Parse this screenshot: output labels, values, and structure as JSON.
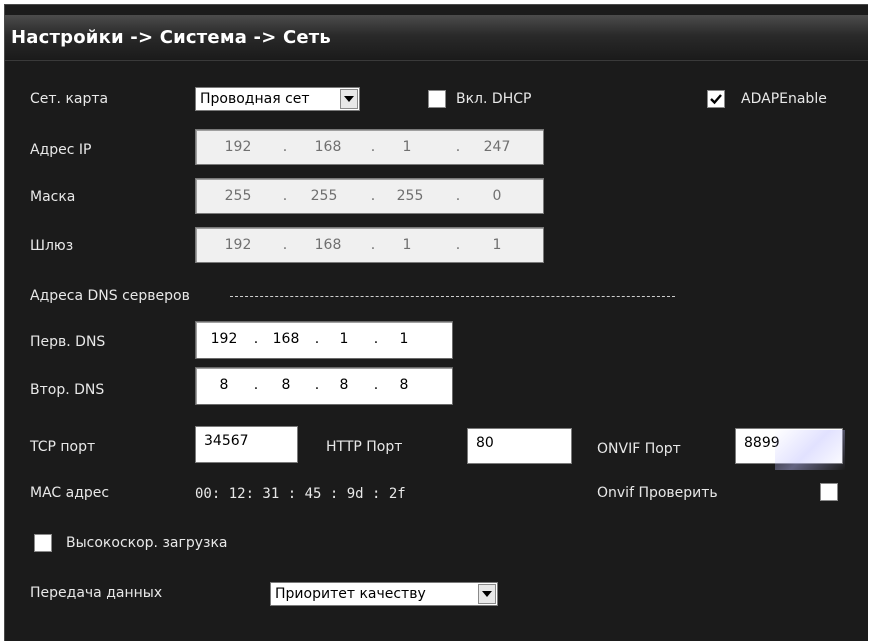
{
  "title": "Настройки -> Система -> Сеть",
  "net_card": {
    "label": "Сет. карта",
    "value": "Проводная сет"
  },
  "dhcp": {
    "label": "Вкл. DHCP",
    "checked": false
  },
  "adap": {
    "label": "ADAPEnable",
    "checked": true
  },
  "ip": {
    "label": "Адрес IP",
    "octets": [
      "192",
      "168",
      "1",
      "247"
    ]
  },
  "mask": {
    "label": "Маска",
    "octets": [
      "255",
      "255",
      "255",
      "0"
    ]
  },
  "gateway": {
    "label": "Шлюз",
    "octets": [
      "192",
      "168",
      "1",
      "1"
    ]
  },
  "dns_section": {
    "label": "Адреса DNS серверов"
  },
  "dns1": {
    "label": "Перв. DNS",
    "octets": [
      "192",
      "168",
      "1",
      "1"
    ]
  },
  "dns2": {
    "label": "Втор. DNS",
    "octets": [
      "8",
      "8",
      "8",
      "8"
    ]
  },
  "tcp": {
    "label": "TCP порт",
    "value": "34567"
  },
  "http": {
    "label": "HTTP Порт",
    "value": "80"
  },
  "onvif": {
    "label": "ONVIF Порт",
    "value": "8899"
  },
  "mac": {
    "label": "MAC адрес",
    "value": "00: 12: 31 : 45 : 9d : 2f"
  },
  "onvif_check": {
    "label": "Onvif Проверить",
    "checked": false
  },
  "highspeed": {
    "label": "Высокоскор. загрузка",
    "checked": false
  },
  "transfer": {
    "label": "Передача данных",
    "value": "Приоритет качеству"
  }
}
